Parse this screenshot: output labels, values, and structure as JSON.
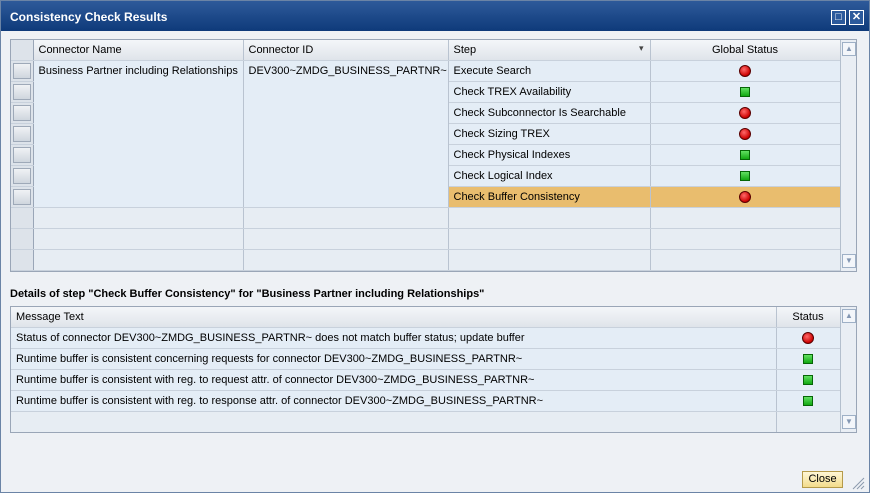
{
  "window": {
    "title": "Consistency Check Results"
  },
  "steps_table": {
    "columns": [
      "Connector Name",
      "Connector ID",
      "Step",
      "Global Status"
    ],
    "connector_name": "Business Partner including Relationships",
    "connector_id": "DEV300~ZMDG_BUSINESS_PARTNR~",
    "rows": [
      {
        "step": "Execute Search",
        "status": "red"
      },
      {
        "step": "Check TREX Availability",
        "status": "green"
      },
      {
        "step": "Check Subconnector Is Searchable",
        "status": "red"
      },
      {
        "step": "Check Sizing TREX",
        "status": "red"
      },
      {
        "step": "Check Physical Indexes",
        "status": "green"
      },
      {
        "step": "Check Logical Index",
        "status": "green"
      },
      {
        "step": "Check Buffer Consistency",
        "status": "red",
        "selected": true
      }
    ]
  },
  "details": {
    "title": "Details of step \"Check Buffer Consistency\" for \"Business Partner including Relationships\"",
    "columns": [
      "Message Text",
      "Status"
    ],
    "rows": [
      {
        "text": "Status of connector DEV300~ZMDG_BUSINESS_PARTNR~ does not match buffer status; update buffer",
        "status": "red"
      },
      {
        "text": "Runtime buffer is consistent concerning requests for connector DEV300~ZMDG_BUSINESS_PARTNR~",
        "status": "green"
      },
      {
        "text": "Runtime buffer is consistent with reg. to request attr. of connector DEV300~ZMDG_BUSINESS_PARTNR~",
        "status": "green"
      },
      {
        "text": "Runtime buffer is consistent with reg. to response attr. of connector DEV300~ZMDG_BUSINESS_PARTNR~",
        "status": "green"
      }
    ]
  },
  "footer": {
    "close_label": "Close"
  },
  "icons": {
    "status_error": "red-light-icon",
    "status_ok": "green-light-icon",
    "filter": "filter-icon"
  },
  "colors": {
    "titlebar": "#0e3a7a",
    "selected_row": "#e9bd6e",
    "cell_bg": "#e4edf6"
  }
}
